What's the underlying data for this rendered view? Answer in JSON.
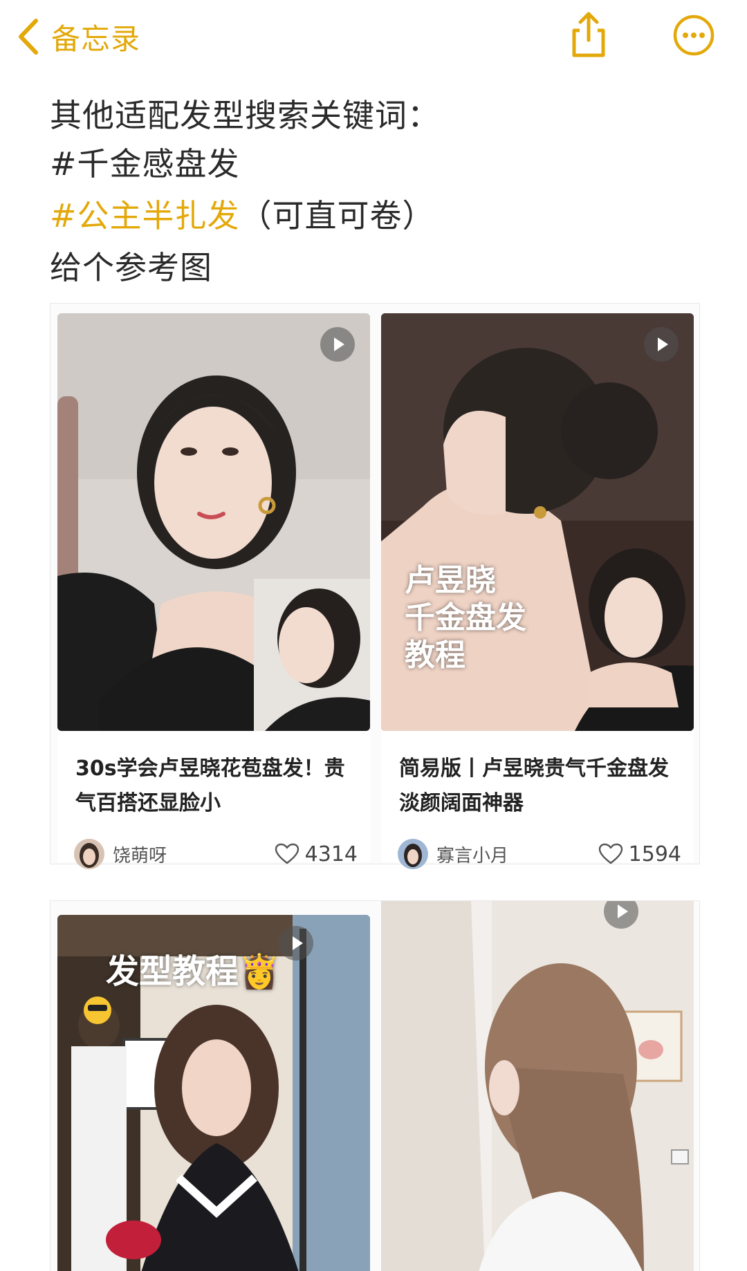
{
  "nav": {
    "back_label": "备忘录",
    "accent": "#E3A809"
  },
  "note": {
    "line1": "其他适配发型搜索关键词：",
    "line2": "#千金感盘发",
    "line3_tag": "#公主半扎发",
    "line3_rest": "（可直可卷）",
    "line4": "给个参考图"
  },
  "cards": [
    {
      "title": "30s学会卢昱晓花苞盘发！贵气百搭还显脸小",
      "author": "饶萌呀",
      "likes": "4314",
      "overlay": ""
    },
    {
      "title": "简易版丨卢昱晓贵气千金盘发 淡颜阔面神器",
      "author": "寡言小月",
      "likes": "1594",
      "overlay_lines": [
        "卢昱晓",
        "千金盘发",
        "教程"
      ]
    },
    {
      "overlay": "发型教程👸"
    },
    {
      "overlay": ""
    }
  ],
  "icons": [
    "chevron-left-icon",
    "share-icon",
    "more-icon",
    "play-icon",
    "heart-icon"
  ]
}
